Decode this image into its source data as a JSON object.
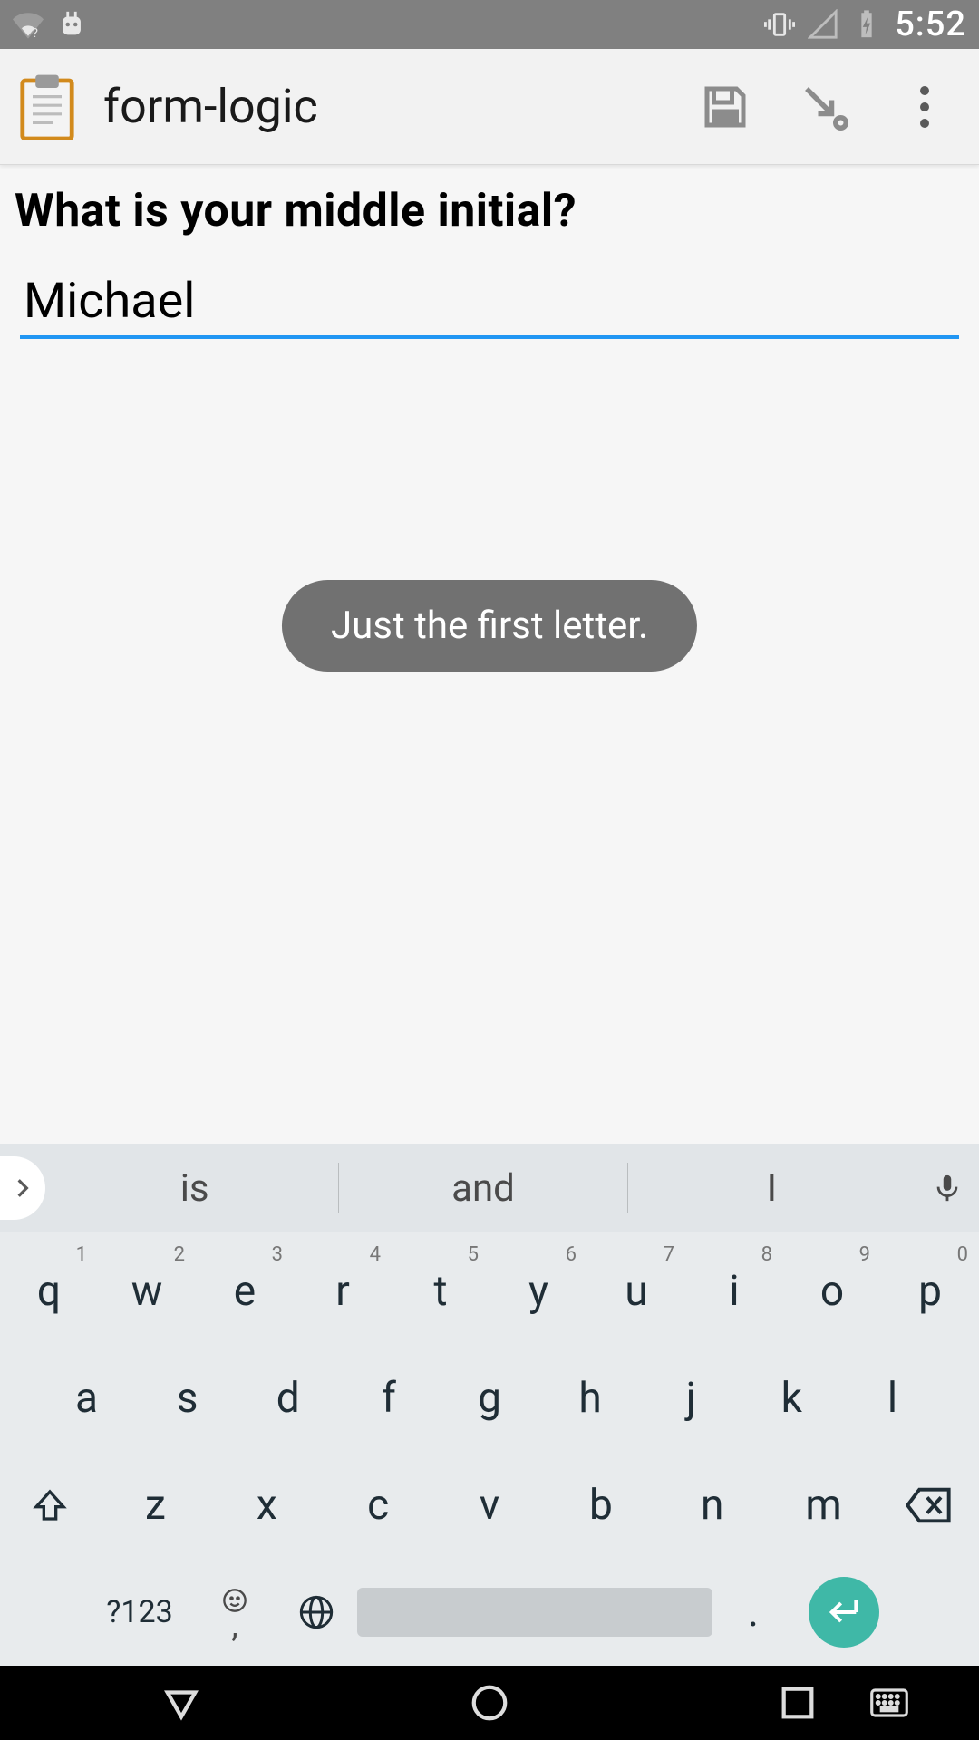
{
  "status_bar": {
    "clock": "5:52"
  },
  "app_bar": {
    "title": "form-logic"
  },
  "form": {
    "question": "What is your middle initial?",
    "input_value": "Michael"
  },
  "toast": {
    "message": "Just the first letter."
  },
  "keyboard": {
    "suggestions": {
      "s1": "is",
      "s2": "and",
      "s3": "I"
    },
    "row1": {
      "k0": {
        "l": "q",
        "a": "1"
      },
      "k1": {
        "l": "w",
        "a": "2"
      },
      "k2": {
        "l": "e",
        "a": "3"
      },
      "k3": {
        "l": "r",
        "a": "4"
      },
      "k4": {
        "l": "t",
        "a": "5"
      },
      "k5": {
        "l": "y",
        "a": "6"
      },
      "k6": {
        "l": "u",
        "a": "7"
      },
      "k7": {
        "l": "i",
        "a": "8"
      },
      "k8": {
        "l": "o",
        "a": "9"
      },
      "k9": {
        "l": "p",
        "a": "0"
      }
    },
    "row2": {
      "k0": "a",
      "k1": "s",
      "k2": "d",
      "k3": "f",
      "k4": "g",
      "k5": "h",
      "k6": "j",
      "k7": "k",
      "k8": "l"
    },
    "row3": {
      "k0": "z",
      "k1": "x",
      "k2": "c",
      "k3": "v",
      "k4": "b",
      "k5": "n",
      "k6": "m"
    },
    "row4": {
      "sym": "?123",
      "dot": "."
    }
  }
}
